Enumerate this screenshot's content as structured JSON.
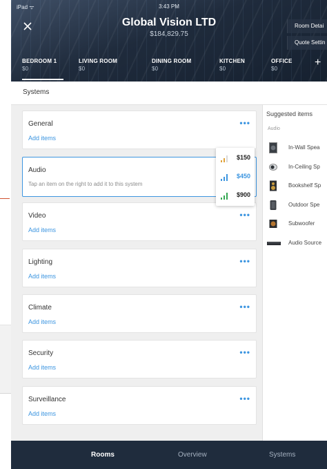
{
  "statusbar": {
    "left": "iPad ᯤ",
    "time": "3:43 PM"
  },
  "header": {
    "company": "Global Vision LTD",
    "total": "$184,829.75",
    "room_details_label": "Room Detai",
    "quote_settings_label": "Quote Settin"
  },
  "tabs": [
    {
      "label": "BEDROOM 1",
      "cost": "$0"
    },
    {
      "label": "LIVING ROOM",
      "cost": "$0"
    },
    {
      "label": "DINING ROOM",
      "cost": "$0"
    },
    {
      "label": "KITCHEN",
      "cost": "$0"
    },
    {
      "label": "OFFICE",
      "cost": "$0"
    }
  ],
  "tab_add": "+",
  "systems_title": "Systems",
  "systems": [
    {
      "title": "General",
      "action": "Add items"
    },
    {
      "title": "Audio",
      "hint": "Tap an item on the right to add it to this system"
    },
    {
      "title": "Video",
      "action": "Add items"
    },
    {
      "title": "Lighting",
      "action": "Add items"
    },
    {
      "title": "Climate",
      "action": "Add items"
    },
    {
      "title": "Security",
      "action": "Add items"
    },
    {
      "title": "Surveillance",
      "action": "Add items"
    }
  ],
  "more_glyph": "•••",
  "tiers": [
    {
      "price": "$150",
      "color": "#e0a23a"
    },
    {
      "price": "$450",
      "color": "#3c95e0"
    },
    {
      "price": "$900",
      "color": "#33a852"
    }
  ],
  "suggested": {
    "title": "Suggested items",
    "category": "Audio",
    "items": [
      {
        "label": "In-Wall Spea",
        "icon": "in-wall-speaker-icon"
      },
      {
        "label": "In-Ceiling Sp",
        "icon": "in-ceiling-speaker-icon"
      },
      {
        "label": "Bookshelf Sp",
        "icon": "bookshelf-speaker-icon"
      },
      {
        "label": "Outdoor Spe",
        "icon": "outdoor-speaker-icon"
      },
      {
        "label": "Subwoofer",
        "icon": "subwoofer-icon"
      },
      {
        "label": "Audio Source",
        "icon": "audio-source-icon"
      }
    ]
  },
  "bottom_nav": [
    {
      "label": "Rooms"
    },
    {
      "label": "Overview"
    },
    {
      "label": "Systems"
    }
  ],
  "colors": {
    "accent": "#3c95e0",
    "header_dark": "#1f2c3d"
  }
}
